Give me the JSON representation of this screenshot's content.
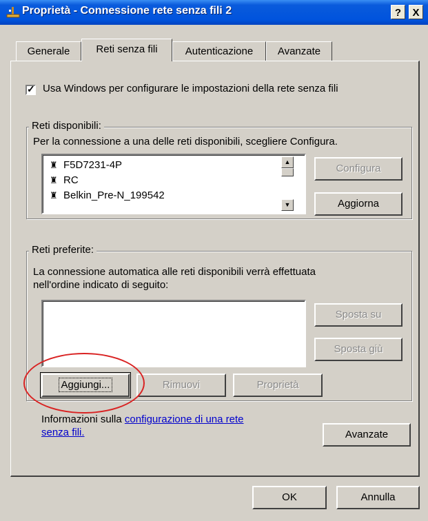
{
  "window": {
    "title": "Proprietà - Connessione rete senza fili 2",
    "help_btn": "?",
    "close_btn": "X"
  },
  "tabs": [
    {
      "label": "Generale"
    },
    {
      "label": "Reti senza fili"
    },
    {
      "label": "Autenticazione"
    },
    {
      "label": "Avanzate"
    }
  ],
  "use_windows": {
    "checked": true,
    "label": "Usa Windows per configurare le impostazioni della rete senza fili"
  },
  "available": {
    "legend": "Reti disponibili:",
    "description": "Per la connessione a una delle reti disponibili, scegliere Configura.",
    "networks": [
      "F5D7231-4P",
      "RC",
      "Belkin_Pre-N_199542"
    ],
    "configure_button": "Configura",
    "refresh_button": "Aggiorna"
  },
  "preferred": {
    "legend": "Reti preferite:",
    "description_line1": "La connessione automatica alle reti disponibili verrà effettuata",
    "description_line2": "nell'ordine indicato di seguito:",
    "move_up_button": "Sposta su",
    "move_down_button": "Sposta giù",
    "add_button": "Aggiungi...",
    "remove_button": "Rimuovi",
    "properties_button": "Proprietà"
  },
  "info": {
    "prefix": "Informazioni sulla ",
    "link1": "configurazione di una rete",
    "link2": "senza fili.",
    "advanced_button": "Avanzate"
  },
  "footer": {
    "ok_button": "OK",
    "cancel_button": "Annulla"
  }
}
